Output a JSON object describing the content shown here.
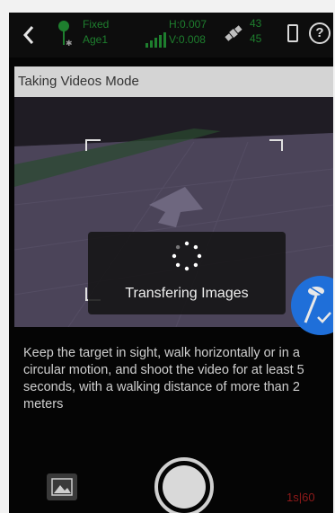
{
  "status_bar": {
    "fix_status": "Fixed",
    "age": "Age1",
    "h_accuracy": "H:0.007",
    "v_accuracy": "V:0.008",
    "sat_a": "43",
    "sat_b": "45",
    "help_label": "?"
  },
  "mode_banner": {
    "title": "Taking Videos Mode"
  },
  "overlay": {
    "message": "Transfering Images"
  },
  "instructions": {
    "text": "Keep the target in sight, walk horizontally or in a circular motion, and shoot the video for at least 5 seconds, with a walking distance of more than 2 meters"
  },
  "bottom_bar": {
    "timer": "1s|60"
  },
  "colors": {
    "accent": "#1f6fd9",
    "status_green": "#1e7f2e",
    "timer_red": "#8f1a1a"
  },
  "icons": [
    "back-icon",
    "rtk-antenna-icon",
    "signal-bars-icon",
    "satellite-icon",
    "battery-icon",
    "help-icon",
    "loading-spinner-icon",
    "survey-pole-icon",
    "gallery-icon",
    "shutter-button"
  ]
}
